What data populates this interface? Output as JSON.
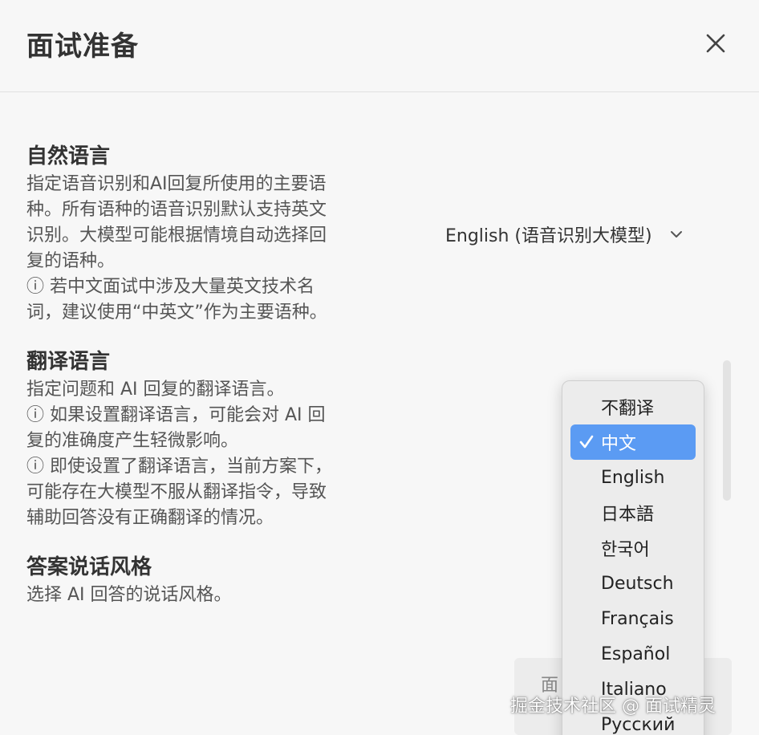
{
  "dialog": {
    "title": "面试准备",
    "close_icon": "close-icon"
  },
  "sections": {
    "natural_language": {
      "title": "自然语言",
      "desc_lines": [
        "指定语音识别和AI回复所使用的主要语",
        "种。所有语种的语音识别默认支持英文",
        "识别。大模型可能根据情境自动选择回",
        "复的语种。",
        "ⓘ 若中文面试中涉及大量英文技术名",
        "词，建议使用“中英文”作为主要语种。"
      ],
      "select_value": "English (语音识别大模型)"
    },
    "translation_language": {
      "title": "翻译语言",
      "desc_lines": [
        "指定问题和 AI 回复的翻译语言。",
        "ⓘ 如果设置翻译语言，可能会对 AI 回",
        "复的准确度产生轻微影响。",
        "ⓘ 即使设置了翻译语言，当前方案下，",
        "可能存在大模型不服从翻译指令，导致",
        "辅助回答没有正确翻译的情况。"
      ]
    },
    "answer_style": {
      "title": "答案说话风格",
      "desc_lines": [
        "选择 AI 回答的说话风格。"
      ]
    }
  },
  "dropdown": {
    "selected": "中文",
    "options": [
      "不翻译",
      "中文",
      "English",
      "日本語",
      "한국어",
      "Deutsch",
      "Français",
      "Español",
      "Italiano",
      "Русский"
    ]
  },
  "bottom_button": {
    "partial_label": "面"
  },
  "watermark": "掘金技术社区 @ 面试精灵",
  "colors": {
    "accent": "#5b9bf3",
    "background": "#f7f7f7"
  }
}
